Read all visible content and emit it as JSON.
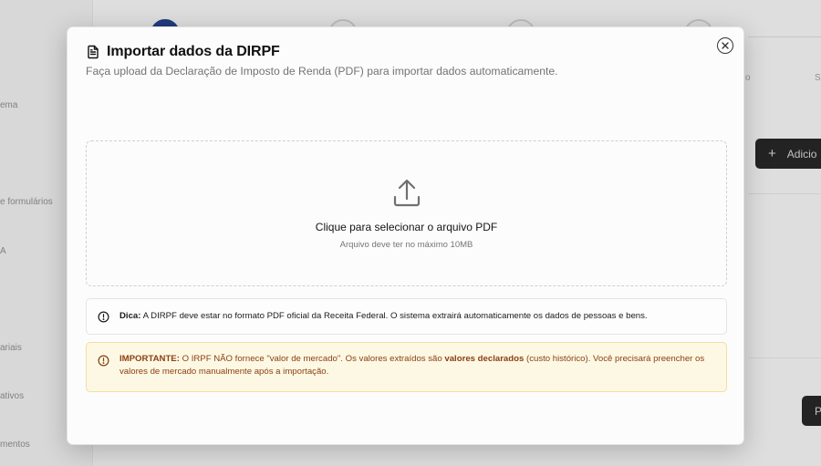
{
  "background": {
    "sidebar_labels": [
      "ema",
      "e formulários",
      "A",
      "ariais",
      "ativos",
      "mentos"
    ],
    "add_button_label": "Adicio",
    "right_button_label": "P",
    "header_fragments": [
      "o",
      "S"
    ]
  },
  "modal": {
    "title": "Importar dados da DIRPF",
    "subtitle": "Faça upload da Declaração de Imposto de Renda (PDF) para importar dados automaticamente.",
    "close_icon": "close-icon",
    "dropzone": {
      "icon": "upload-icon",
      "title": "Clique para selecionar o arquivo PDF",
      "hint": "Arquivo deve ter no máximo 10MB"
    },
    "tip": {
      "icon": "info-icon",
      "label": "Dica:",
      "text": " A DIRPF deve estar no formato PDF oficial da Receita Federal. O sistema extrairá automaticamente os dados de pessoas e bens."
    },
    "important": {
      "icon": "info-icon",
      "label": "IMPORTANTE:",
      "text_before": " O IRPF NÃO fornece \"valor de mercado\". Os valores extraídos são ",
      "highlight": "valores declarados",
      "text_after": " (custo histórico). Você precisará preencher os valores de mercado manualmente após a importação."
    }
  },
  "colors": {
    "accent_step": "#263f86",
    "important_bg": "#fdf8e4",
    "important_border": "#f3de9d",
    "important_text": "#8a3f12"
  }
}
